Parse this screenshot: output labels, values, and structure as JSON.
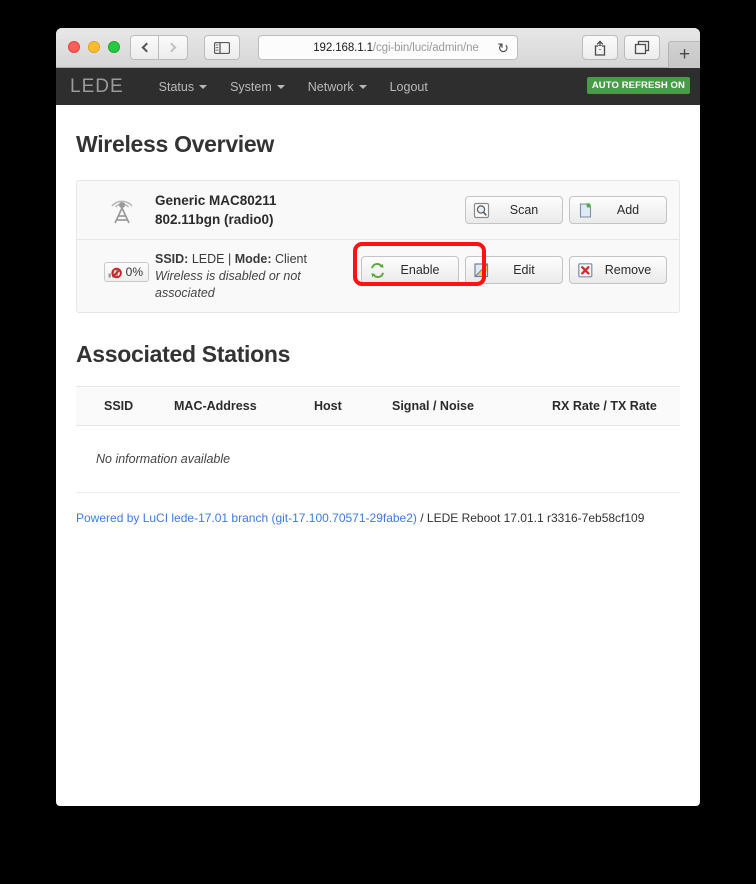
{
  "browser": {
    "url_host": "192.168.1.1",
    "url_path": "/cgi-bin/luci/admin/ne",
    "reload_icon": "reload-icon",
    "back_icon": "chevron-left-icon",
    "forward_icon": "chevron-right-icon",
    "sidebar_icon": "sidebar-toggle-icon",
    "share_icon": "share-icon",
    "tabs_icon": "show-tabs-icon",
    "newtab_label": "+"
  },
  "header": {
    "logo": "LEDE",
    "menu": [
      {
        "label": "Status",
        "has_caret": true
      },
      {
        "label": "System",
        "has_caret": true
      },
      {
        "label": "Network",
        "has_caret": true
      },
      {
        "label": "Logout",
        "has_caret": false
      }
    ],
    "refresh_badge": "AUTO REFRESH ON",
    "badge_color": "#4a9a4a"
  },
  "main": {
    "page_title": "Wireless Overview",
    "radio": {
      "icon": "wifi-tower-icon",
      "name_line1": "Generic MAC80211",
      "name_line2": "802.11bgn (radio0)",
      "scan_label": "Scan",
      "add_label": "Add"
    },
    "iface": {
      "signal_percent": "0%",
      "signal_icon": "signal-disabled-icon",
      "ssid_label": "SSID:",
      "ssid_value": "LEDE",
      "separator": "|",
      "mode_label": "Mode:",
      "mode_value": "Client",
      "status": "Wireless is disabled or not associated",
      "enable_label": "Enable",
      "edit_label": "Edit",
      "remove_label": "Remove",
      "highlight_color": "#ff1212"
    },
    "stations": {
      "title": "Associated Stations",
      "columns": [
        "SSID",
        "MAC-Address",
        "Host",
        "Signal / Noise",
        "RX Rate / TX Rate"
      ],
      "empty_message": "No information available"
    }
  },
  "footer": {
    "link_text": "Powered by LuCI lede-17.01 branch (git-17.100.70571-29fabe2)",
    "suffix": " / LEDE Reboot 17.01.1 r3316-7eb58cf109",
    "link_color": "#3d7be8"
  }
}
